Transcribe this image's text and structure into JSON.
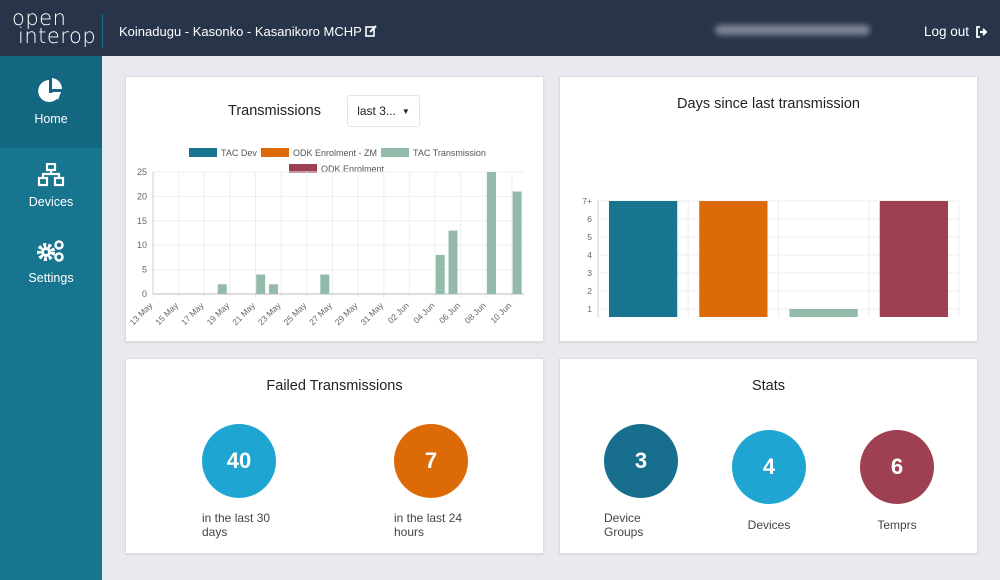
{
  "header": {
    "logo_line1": "open",
    "logo_line2": "interop",
    "site": "Koinadugu - Kasonko - Kasanikoro MCHP",
    "logout": "Log out"
  },
  "sidebar": {
    "items": [
      {
        "label": "Home",
        "icon": "pie-chart-icon",
        "active": true
      },
      {
        "label": "Devices",
        "icon": "network-icon"
      },
      {
        "label": "Settings",
        "icon": "gears-icon"
      }
    ]
  },
  "colors": {
    "tac_dev": "#177590",
    "odk_zm": "#dc6a07",
    "tac_trans": "#93bba9",
    "odk_enrol": "#9e4051"
  },
  "transmissions": {
    "title": "Transmissions",
    "dropdown": "last 3...",
    "chart_data": {
      "type": "bar",
      "legend": [
        "TAC Dev",
        "ODK Enrolment - ZM",
        "TAC Transmission",
        "ODK Enrolment"
      ],
      "legend_placement": "top",
      "ylim": [
        0,
        25
      ],
      "yticks": [
        0,
        5,
        10,
        15,
        20,
        25
      ],
      "xticks": [
        "13 May",
        "15 May",
        "17 May",
        "19 May",
        "21 May",
        "23 May",
        "25 May",
        "27 May",
        "29 May",
        "31 May",
        "02 Jun",
        "04 Jun",
        "06 Jun",
        "08 Jun",
        "10 Jun"
      ],
      "series": [
        {
          "name": "TAC Transmission",
          "points": [
            [
              "18 May",
              2
            ],
            [
              "21 May",
              4
            ],
            [
              "22 May",
              2
            ],
            [
              "26 May",
              4
            ],
            [
              "04 Jun",
              8
            ],
            [
              "05 Jun",
              13
            ],
            [
              "08 Jun",
              25
            ],
            [
              "10 Jun",
              21
            ]
          ]
        }
      ],
      "grid": true
    }
  },
  "days_since": {
    "title": "Days since last transmission",
    "chart_data": {
      "type": "bar",
      "categories": [
        "TAC Dev",
        "ODK Enrolment - ZM",
        "TAC Transmission",
        "ODK Enrolment"
      ],
      "values": [
        7,
        7,
        1,
        7
      ],
      "ylim": [
        0,
        7
      ],
      "yticks": [
        "0",
        "1",
        "2",
        "3",
        "4",
        "5",
        "6",
        "7+"
      ],
      "grid": true
    }
  },
  "failed": {
    "title": "Failed Transmissions",
    "items": [
      {
        "value": "40",
        "label1": "in the last 30",
        "label2": "days"
      },
      {
        "value": "7",
        "label1": "in the last 24",
        "label2": "hours"
      }
    ]
  },
  "stats": {
    "title": "Stats",
    "items": [
      {
        "value": "3",
        "label1": "Device",
        "label2": "Groups"
      },
      {
        "value": "4",
        "label1": "Devices"
      },
      {
        "value": "6",
        "label1": "Temprs"
      }
    ]
  }
}
